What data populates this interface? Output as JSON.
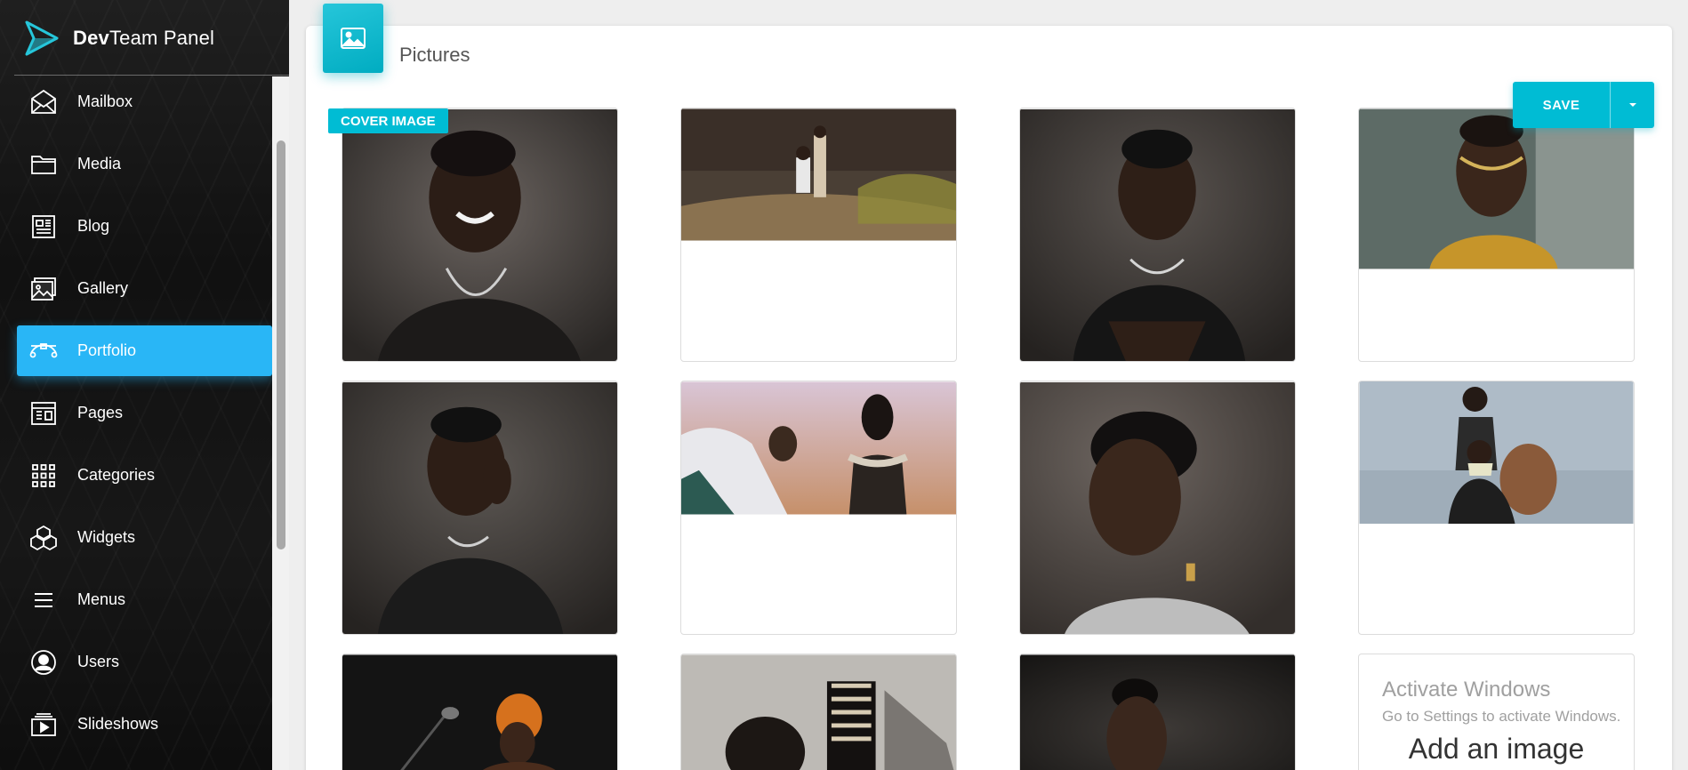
{
  "app": {
    "brand_bold": "Dev",
    "brand_rest": "Team Panel"
  },
  "sidebar": {
    "items": [
      {
        "label": "Mailbox",
        "icon": "mailbox-icon",
        "active": false
      },
      {
        "label": "Media",
        "icon": "folder-icon",
        "active": false
      },
      {
        "label": "Blog",
        "icon": "blog-icon",
        "active": false
      },
      {
        "label": "Gallery",
        "icon": "gallery-icon",
        "active": false
      },
      {
        "label": "Portfolio",
        "icon": "portfolio-icon",
        "active": true
      },
      {
        "label": "Pages",
        "icon": "pages-icon",
        "active": false
      },
      {
        "label": "Categories",
        "icon": "categories-icon",
        "active": false
      },
      {
        "label": "Widgets",
        "icon": "widgets-icon",
        "active": false
      },
      {
        "label": "Menus",
        "icon": "menu-icon",
        "active": false
      },
      {
        "label": "Users",
        "icon": "users-icon",
        "active": false
      },
      {
        "label": "Slideshows",
        "icon": "slideshows-icon",
        "active": false
      }
    ]
  },
  "main": {
    "title": "Pictures",
    "save_label": "SAVE",
    "cover_badge": "COVER IMAGE",
    "add_image_label": "Add an image"
  },
  "watermark": {
    "line1": "Activate Windows",
    "line2": "Go to Settings to activate Windows."
  },
  "colors": {
    "accent": "#00bcd4",
    "active_nav": "#29b6f6"
  }
}
